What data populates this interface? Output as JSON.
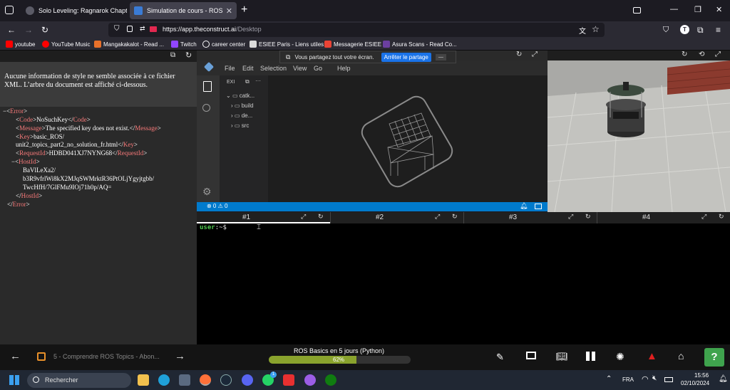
{
  "browser": {
    "tabs": [
      {
        "label": "Solo Leveling: Ragnarok Chapte",
        "active": false
      },
      {
        "label": "Simulation de cours - ROS Basic",
        "active": true
      }
    ],
    "new_tab": "+",
    "url_domain": "https://app.theconstruct.ai",
    "url_path": "/Desktop",
    "bookmarks": [
      {
        "label": "youtube",
        "color": "#ff0000"
      },
      {
        "label": "YouTube Music",
        "color": "#ff0000"
      },
      {
        "label": "Mangakakalot - Read ...",
        "color": "#e8702a"
      },
      {
        "label": "Twitch",
        "color": "#9146ff"
      },
      {
        "label": "career center",
        "color": "#ffffff"
      },
      {
        "label": "ESIEE Paris - Liens utiles",
        "color": "#ffffff"
      },
      {
        "label": "Messagerie ESIEE",
        "color": "#ea4335"
      },
      {
        "label": "Asura Scans - Read Co...",
        "color": "#6b3fa0"
      }
    ]
  },
  "xml_viewer": {
    "notice": "Aucune information de style ne semble associée à ce fichier XML. L’arbre du document est affiché ci-dessous.",
    "error_tag": "Error",
    "code_tag": "Code",
    "code_value": "NoSuchKey",
    "message_tag": "Message",
    "message_value": "The specified key does not exist.",
    "key_tag": "Key",
    "key_value_1": "basic_ROS/",
    "key_value_2": "unit2_topics_part2_no_solution_fr.html",
    "requestid_tag": "RequestId",
    "requestid_value": "HDBD041XJ7NYNG68",
    "hostid_tag": "HostId",
    "hostid_value_1": "BaVlLeXa2/",
    "hostid_value_2": "b3R9vfrlWi8kX2MJqSWMrktR36PtOLjYgyjtgbb/",
    "hostid_value_3": "TwcHfH/7GlFMu9IOj71h0p/AQ="
  },
  "share_banner": {
    "text": "Vous partagez tout votre écran.",
    "stop_button": "Arrêter le partage",
    "minimize": "—"
  },
  "ide": {
    "menu": [
      "File",
      "Edit",
      "Selection",
      "View",
      "Go",
      "Help"
    ],
    "explorer_label": "EXI",
    "tree": [
      {
        "label": "catk...",
        "expanded": true
      },
      {
        "label": "build",
        "expanded": false
      },
      {
        "label": "de...",
        "expanded": false
      },
      {
        "label": "src",
        "expanded": false
      }
    ],
    "status": "⊗ 0 ⚠ 0"
  },
  "terminal": {
    "tabs": [
      "#1",
      "#2",
      "#3",
      "#4"
    ],
    "prompt_user": "user",
    "prompt_path": ":~$"
  },
  "course": {
    "nav_label": "5 - Comprendre ROS Topics - Abon...",
    "title": "ROS Basics en 5 jours (Python)",
    "progress_label": "62%",
    "progress_fraction": 0.62,
    "help": "?"
  },
  "taskbar": {
    "search_placeholder": "Rechercher",
    "lang": "FRA",
    "time": "15:56",
    "date": "02/10/2024",
    "whatsapp_badge": "1"
  }
}
